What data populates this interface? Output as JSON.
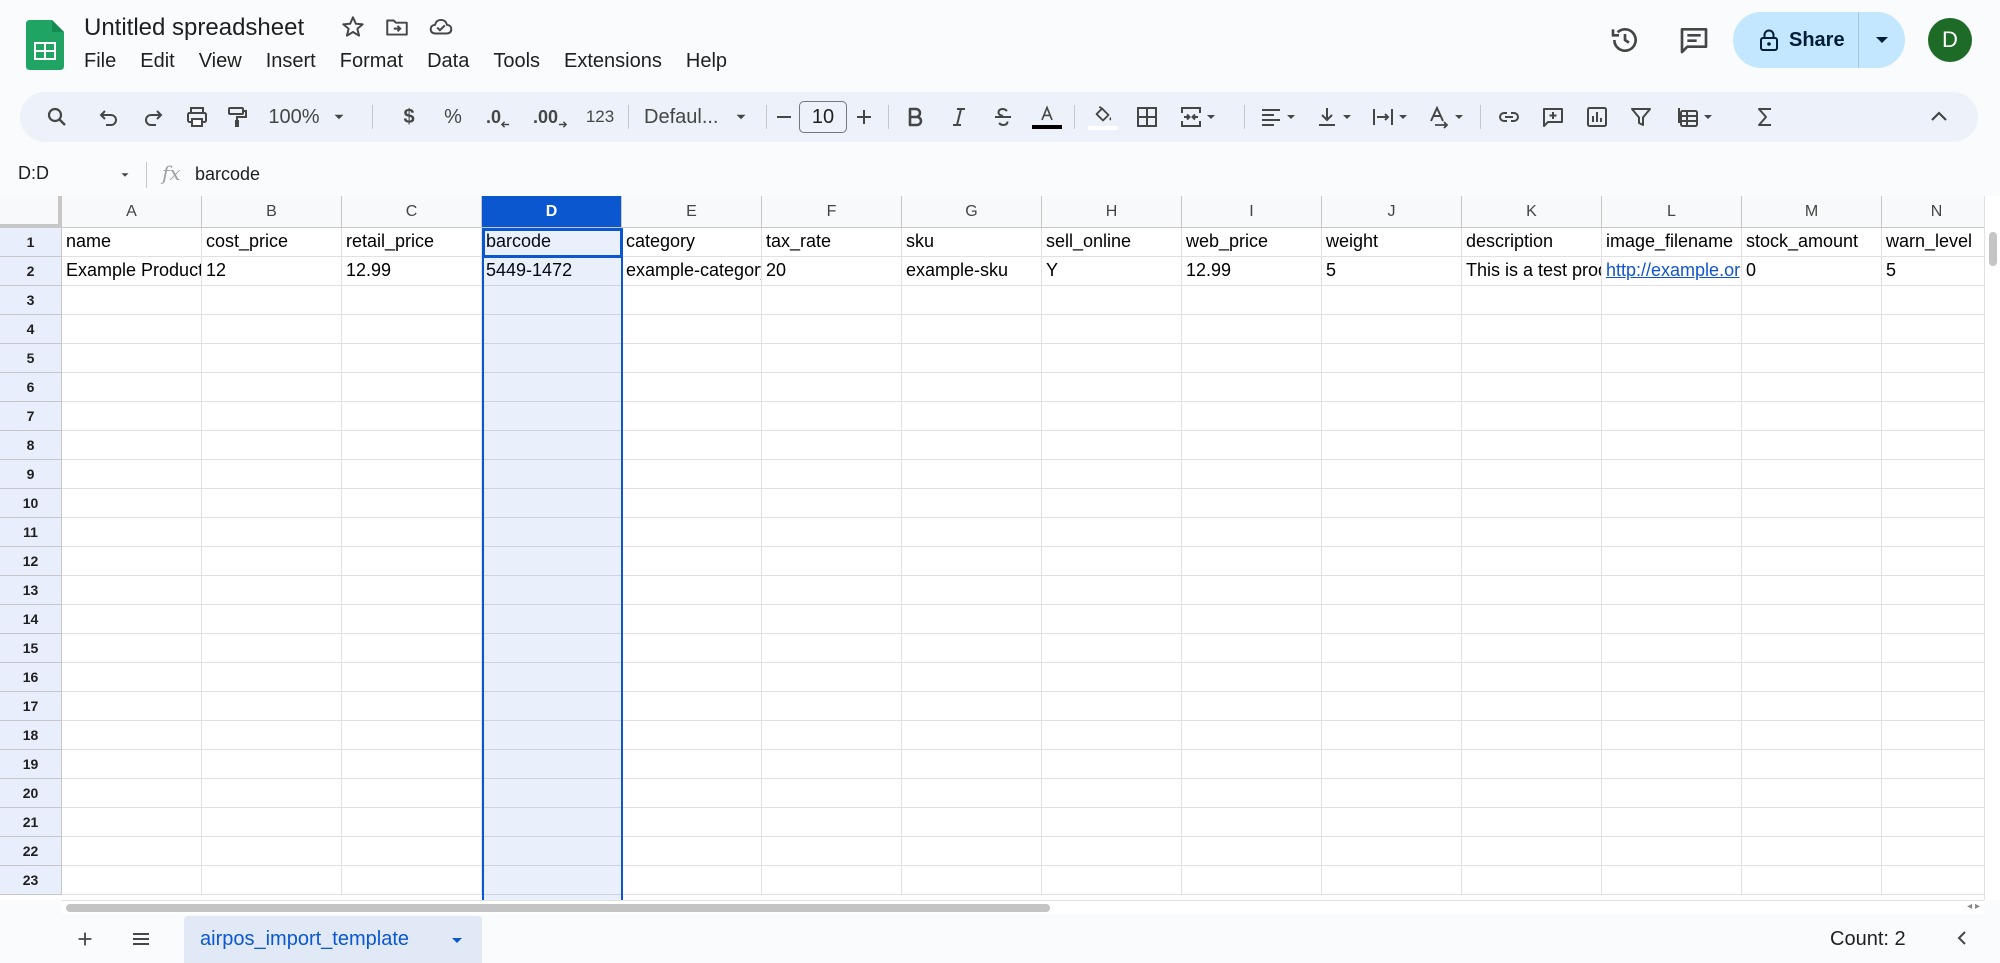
{
  "doc": {
    "title": "Untitled spreadsheet"
  },
  "menu": [
    "File",
    "Edit",
    "View",
    "Insert",
    "Format",
    "Data",
    "Tools",
    "Extensions",
    "Help"
  ],
  "share": {
    "label": "Share"
  },
  "avatar": {
    "initial": "D"
  },
  "toolbar": {
    "zoom": "100%",
    "currency": "$",
    "percent": "%",
    "dec_decrease": ".0",
    "dec_increase": ".00",
    "number_format": "123",
    "font": "Defaul...",
    "font_size": "10"
  },
  "formula": {
    "namebox": "D:D",
    "fx": "fx",
    "content": "barcode"
  },
  "columns": [
    "A",
    "B",
    "C",
    "D",
    "E",
    "F",
    "G",
    "H",
    "I",
    "J",
    "K",
    "L",
    "M",
    "N"
  ],
  "rows": [
    "1",
    "2",
    "3",
    "4",
    "5",
    "6",
    "7",
    "8",
    "9",
    "10",
    "11",
    "12",
    "13",
    "14",
    "15",
    "16",
    "17",
    "18",
    "19",
    "20",
    "21",
    "22",
    "23"
  ],
  "cells": {
    "r1": [
      "name",
      "cost_price",
      "retail_price",
      "barcode",
      "category",
      "tax_rate",
      "sku",
      "sell_online",
      "web_price",
      "weight",
      "description",
      "image_filename",
      "stock_amount",
      "warn_level"
    ],
    "r2": [
      "Example Product",
      "12",
      "12.99",
      "5449-1472",
      "example-category",
      "20",
      "example-sku",
      "Y",
      "12.99",
      "5",
      "This is a test product",
      "http://example.org",
      "0",
      "5"
    ]
  },
  "selection": {
    "column": "D"
  },
  "sheet": {
    "name": "airpos_import_template"
  },
  "status": {
    "count": "Count: 2"
  },
  "colors": {
    "accent": "#0b57d0",
    "share_bg": "#c2e7ff",
    "avatar_bg": "#1e6b28",
    "link": "#1155cc"
  }
}
